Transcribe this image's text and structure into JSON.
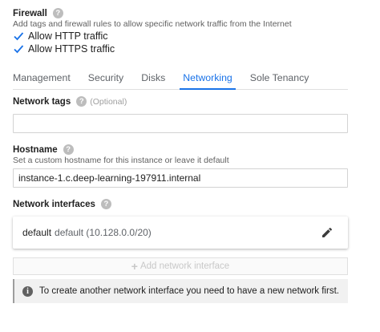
{
  "firewall": {
    "title": "Firewall",
    "description": "Add tags and firewall rules to allow specific network traffic from the Internet",
    "checkboxes": [
      {
        "label": "Allow HTTP traffic",
        "checked": true
      },
      {
        "label": "Allow HTTPS traffic",
        "checked": true
      }
    ]
  },
  "tabs": [
    {
      "label": "Management",
      "active": false
    },
    {
      "label": "Security",
      "active": false
    },
    {
      "label": "Disks",
      "active": false
    },
    {
      "label": "Networking",
      "active": true
    },
    {
      "label": "Sole Tenancy",
      "active": false
    }
  ],
  "network_tags": {
    "title": "Network tags",
    "optional": "(Optional)",
    "value": ""
  },
  "hostname": {
    "title": "Hostname",
    "description": "Set a custom hostname for this instance or leave it default",
    "value": "instance-1.c.deep-learning-197911.internal"
  },
  "network_interfaces": {
    "title": "Network interfaces",
    "items": [
      {
        "name": "default",
        "detail": "default (10.128.0.0/20)"
      }
    ],
    "add_button": "Add network interface",
    "info": "To create another network interface you need to have a new network first."
  },
  "colors": {
    "accent": "#1a73e8",
    "text": "#212121",
    "muted": "#5f6368"
  }
}
